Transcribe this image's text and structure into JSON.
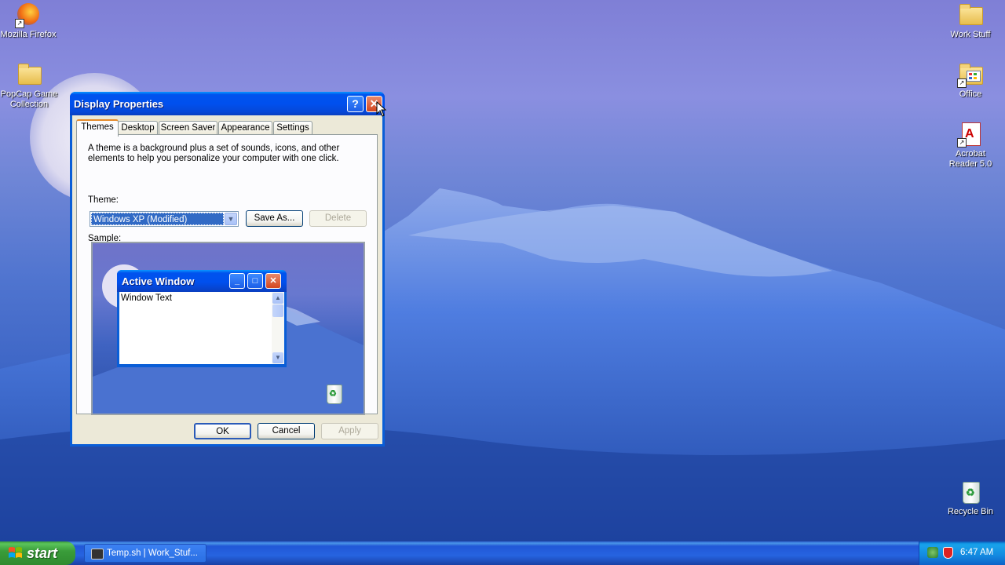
{
  "desktop_icons": [
    {
      "label": "Mozilla Firefox",
      "icon": "firefox-icon"
    },
    {
      "label": "PopCap Game Collection",
      "icon": "folder-icon"
    },
    {
      "label": "Work Stuff",
      "icon": "folder-icon"
    },
    {
      "label": "Office",
      "icon": "office-folder-icon"
    },
    {
      "label": "Acrobat Reader 5.0",
      "icon": "acrobat-icon"
    },
    {
      "label": "Recycle Bin",
      "icon": "recycle-bin-icon"
    }
  ],
  "dialog": {
    "title": "Display Properties",
    "help_glyph": "?",
    "close_glyph": "✕",
    "tabs": [
      "Themes",
      "Desktop",
      "Screen Saver",
      "Appearance",
      "Settings"
    ],
    "active_tab": "Themes",
    "description": "A theme is a background plus a set of sounds, icons, and other elements to help you personalize your computer with one click.",
    "theme_label": "Theme:",
    "theme_value": "Windows XP (Modified)",
    "save_as_label": "Save As...",
    "delete_label": "Delete",
    "sample_label": "Sample:",
    "sample": {
      "window_title": "Active Window",
      "window_text": "Window Text"
    },
    "ok_label": "OK",
    "cancel_label": "Cancel",
    "apply_label": "Apply"
  },
  "taskbar": {
    "start_label": "start",
    "task_item": "Temp.sh | Work_Stuf...",
    "clock": "6:47 AM"
  },
  "colors": {
    "title_bar": "#0050ee",
    "start_green": "#3a9d3a",
    "selection": "#316ac5"
  }
}
